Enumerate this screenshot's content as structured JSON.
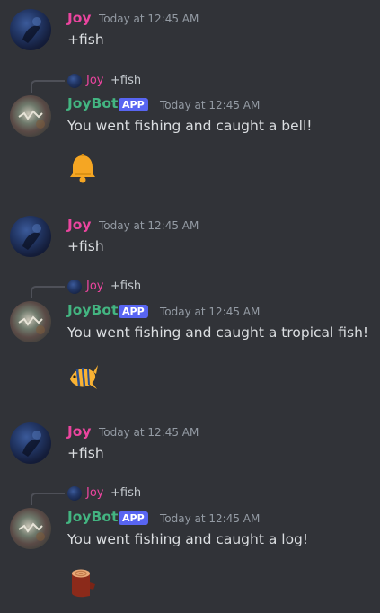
{
  "messages": [
    {
      "type": "user",
      "author": "Joy",
      "time": "Today at 12:45 AM",
      "text": "+fish"
    },
    {
      "type": "bot",
      "reply_author": "Joy",
      "reply_text": "+fish",
      "author": "JoyBot",
      "badge": "APP",
      "time": "Today at 12:45 AM",
      "text": "You went fishing and caught a bell!",
      "emoji": "bell-icon"
    },
    {
      "type": "user",
      "author": "Joy",
      "time": "Today at 12:45 AM",
      "text": "+fish"
    },
    {
      "type": "bot",
      "reply_author": "Joy",
      "reply_text": "+fish",
      "author": "JoyBot",
      "badge": "APP",
      "time": "Today at 12:45 AM",
      "text": "You went fishing and caught a tropical fish!",
      "emoji": "tropical-fish-icon"
    },
    {
      "type": "user",
      "author": "Joy",
      "time": "Today at 12:45 AM",
      "text": "+fish"
    },
    {
      "type": "bot",
      "reply_author": "Joy",
      "reply_text": "+fish",
      "author": "JoyBot",
      "badge": "APP",
      "time": "Today at 12:45 AM",
      "text": "You went fishing and caught a log!",
      "emoji": "log-icon"
    }
  ],
  "colors": {
    "user_name": "#eb459f",
    "bot_name": "#43b581",
    "badge": "#5865f2",
    "background": "#313338"
  }
}
